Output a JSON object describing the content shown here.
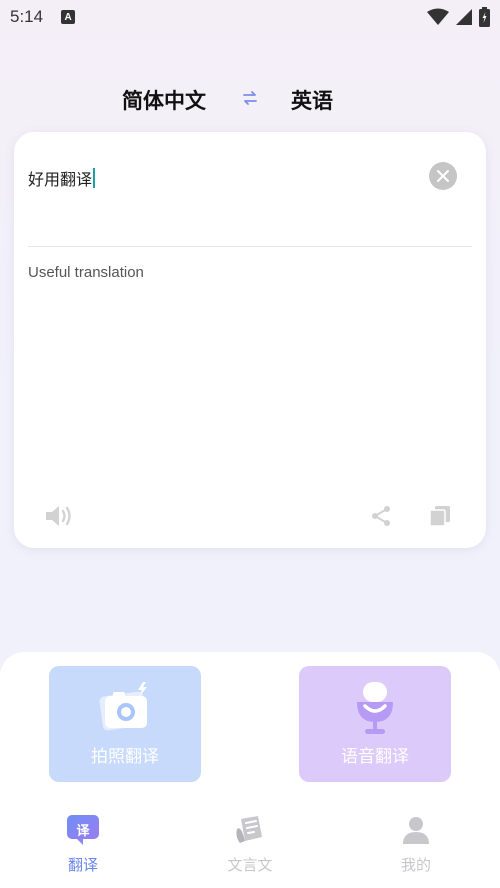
{
  "status": {
    "time": "5:14",
    "a_badge": "A"
  },
  "lang": {
    "source": "简体中文",
    "target": "英语"
  },
  "card": {
    "input": "好用翻译",
    "output": "Useful translation"
  },
  "actions": {
    "photo_label": "拍照翻译",
    "voice_label": "语音翻译"
  },
  "nav": {
    "items": [
      {
        "label": "翻译",
        "icon_text": "译",
        "active": true
      },
      {
        "label": "文言文",
        "active": false
      },
      {
        "label": "我的",
        "active": false
      }
    ]
  },
  "colors": {
    "accent": "#6b86f0",
    "inactive": "#c8c8cc",
    "photo_bg": "#c7dafc",
    "voice_bg": "#dccafb",
    "caret": "#1aa3a3"
  }
}
